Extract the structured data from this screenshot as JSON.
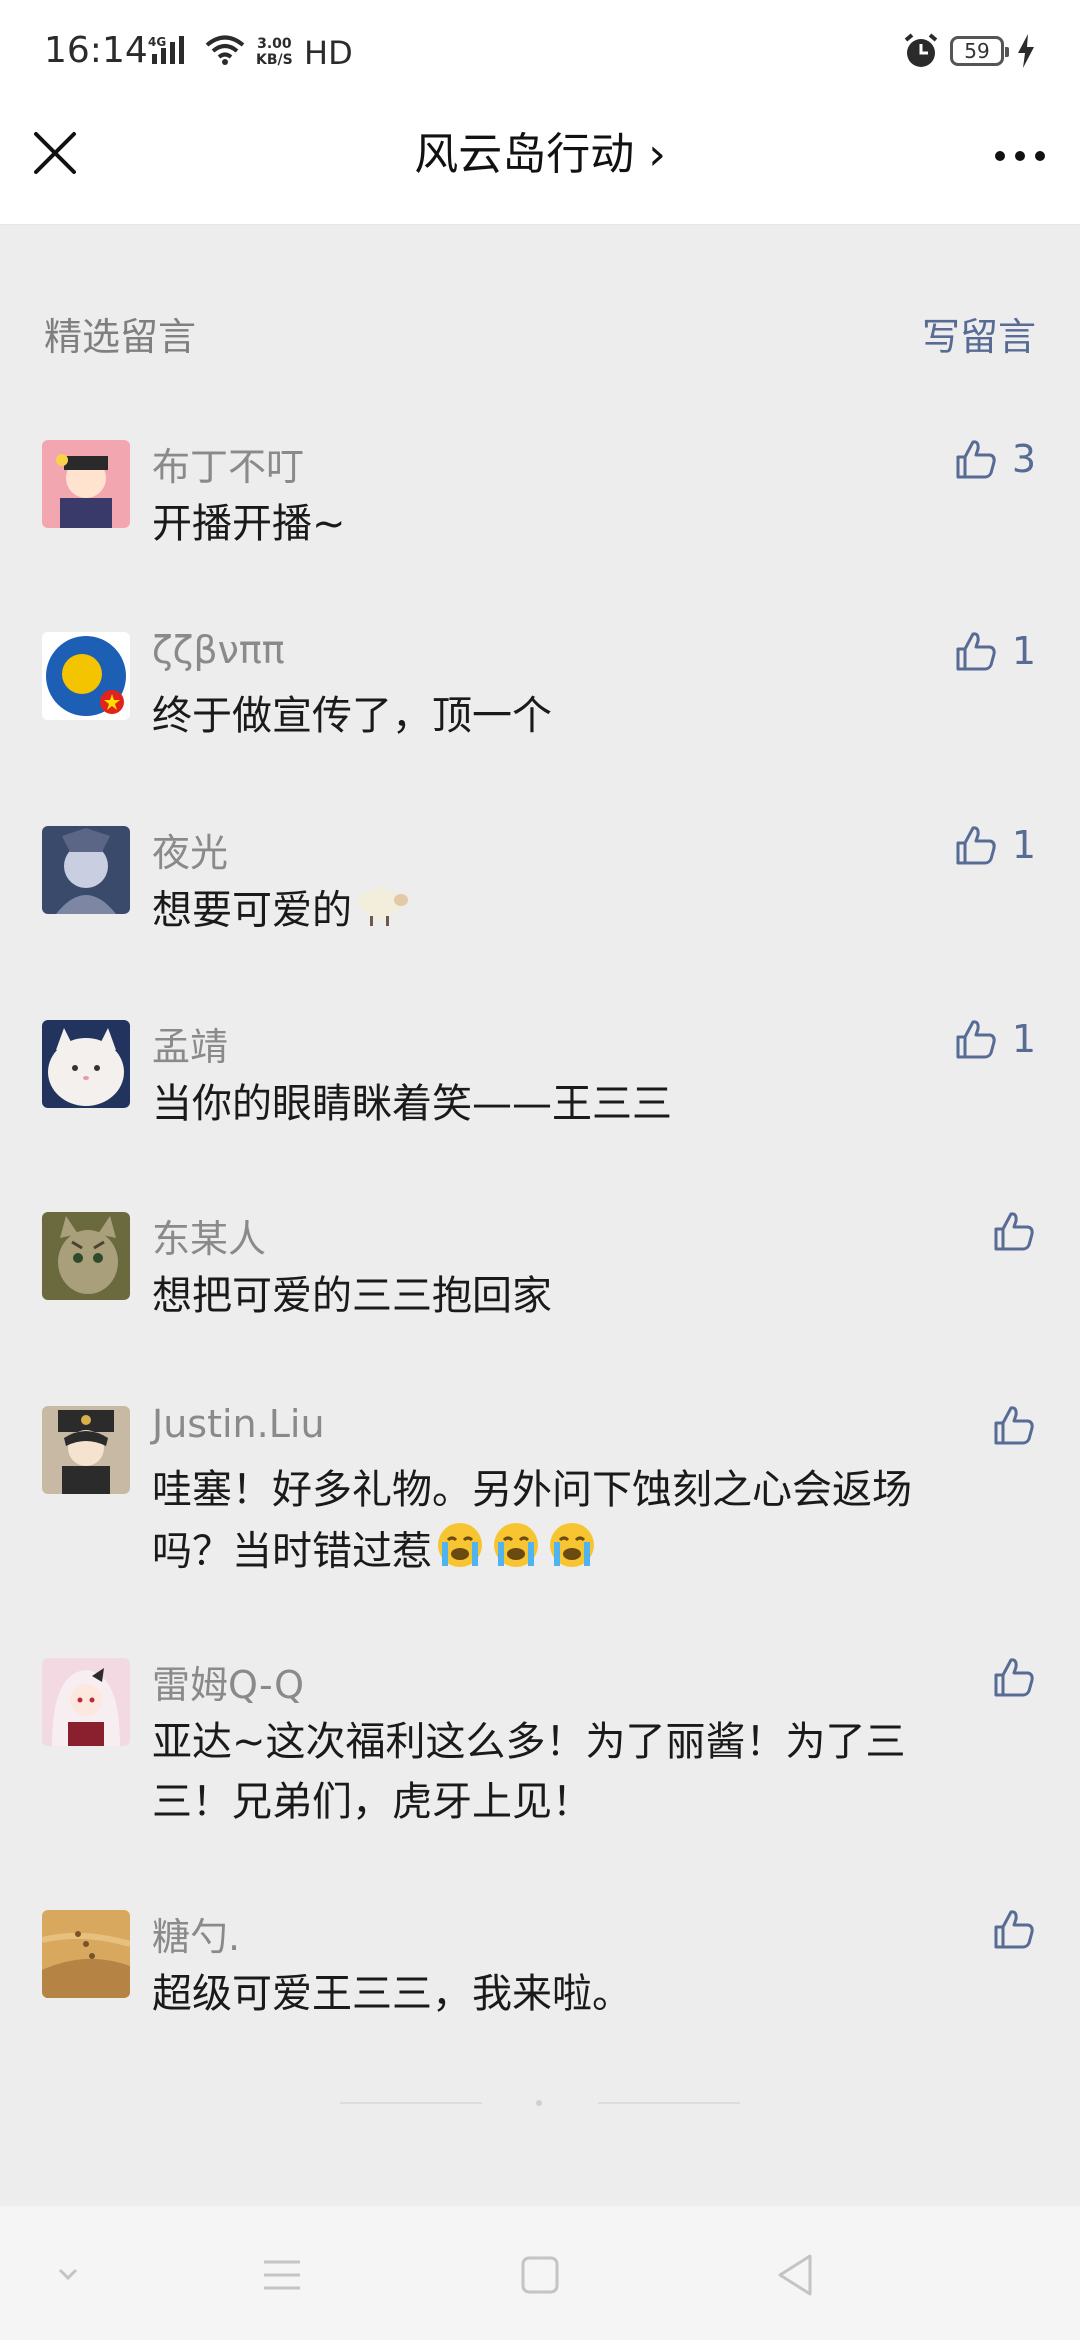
{
  "status_bar": {
    "time": "16:14",
    "network": "4G",
    "speed_value": "3.00",
    "speed_unit": "KB/S",
    "hd": "HD",
    "battery": "59"
  },
  "header": {
    "title": "风云岛行动 ›"
  },
  "section": {
    "title": "精选留言",
    "write_label": "写留言"
  },
  "comments": [
    {
      "name": "布丁不叮",
      "text": "开播开播~",
      "likes": "3",
      "avatar_colors": [
        "#f2a6b0",
        "#3a3a6a"
      ]
    },
    {
      "name": "ζζβνππ",
      "text": "终于做宣传了，顶一个",
      "likes": "1",
      "avatar_colors": [
        "#1d5fb4",
        "#f5c400"
      ]
    },
    {
      "name": "夜光",
      "text": "想要可爱的",
      "likes": "1",
      "avatar_colors": [
        "#3a4a6b",
        "#c9cfe0"
      ]
    },
    {
      "name": "孟靖",
      "text": "当你的眼睛眯着笑——王三三",
      "likes": "1",
      "avatar_colors": [
        "#f3f0ee",
        "#22335e"
      ]
    },
    {
      "name": "东某人",
      "text": "想把可爱的三三抱回家",
      "likes": "",
      "avatar_colors": [
        "#6b6a3e",
        "#a99f7a"
      ]
    },
    {
      "name": "Justin.Liu",
      "text_lines": [
        "哇塞！好多礼物。另外问下蚀刻之心会返场",
        "吗？当时错过惹"
      ],
      "likes": "",
      "avatar_colors": [
        "#2b2b2b",
        "#c7b9a4"
      ]
    },
    {
      "name": "雷姆Q-Q",
      "text_lines": [
        "亚达~这次福利这么多！为了丽酱！为了三",
        "三！兄弟们，虎牙上见！"
      ],
      "likes": "",
      "avatar_colors": [
        "#f2d9e2",
        "#8a1f2d"
      ]
    },
    {
      "name": "糖勺.",
      "text": "超级可爱王三三，我来啦。",
      "likes": "",
      "avatar_colors": [
        "#d9a85f",
        "#b58445"
      ]
    }
  ],
  "icons": {
    "close": "close-icon",
    "more": "more-icon",
    "like": "thumbs-up-icon",
    "sheep": "sheep-emoji",
    "crying": "crying-face-emoji"
  },
  "colors": {
    "accent": "#576b95",
    "muted": "#8a8a8a",
    "background": "#ededed"
  }
}
